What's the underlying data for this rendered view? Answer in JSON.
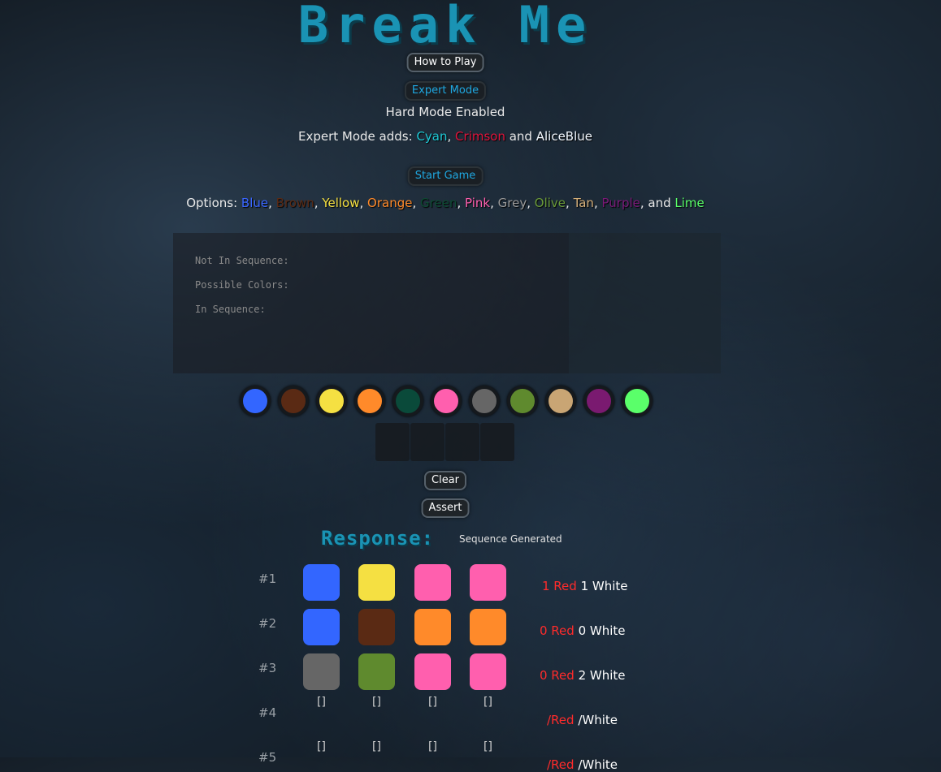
{
  "title": "Break Me",
  "buttons": {
    "how_to_play": "How to Play",
    "expert_mode": "Expert Mode",
    "start_game": "Start Game",
    "clear": "Clear",
    "assert": "Assert"
  },
  "hard_mode_text": "Hard Mode Enabled",
  "expert_text": {
    "prefix": "Expert Mode adds: ",
    "c1": "Cyan",
    "sep1": ", ",
    "c2": "Crimson",
    "sep2": " and ",
    "c3": "AliceBlue"
  },
  "options": {
    "prefix": "Options: ",
    "colors": [
      {
        "name": "Blue",
        "hex": "#3a66ff"
      },
      {
        "name": "Brown",
        "hex": "#5a2a14"
      },
      {
        "name": "Yellow",
        "hex": "#f5e042"
      },
      {
        "name": "Orange",
        "hex": "#ff8a2a"
      },
      {
        "name": "Green",
        "hex": "#0d4a32"
      },
      {
        "name": "Pink",
        "hex": "#ff5fae"
      },
      {
        "name": "Grey",
        "hex": "#9a9a9a"
      },
      {
        "name": "Olive",
        "hex": "#6a9a3a"
      },
      {
        "name": "Tan",
        "hex": "#d6b07a"
      },
      {
        "name": "Purple",
        "hex": "#7a1a78"
      },
      {
        "name": "Lime",
        "hex": "#5aff6a"
      }
    ],
    "and_text": ", and "
  },
  "analysis_labels": {
    "not_in_sequence": "Not In Sequence:",
    "possible_colors": "Possible Colors:",
    "in_sequence": "In Sequence:"
  },
  "palette": [
    "#3366ff",
    "#5a2a14",
    "#f5e042",
    "#ff8a2a",
    "#0a4a3a",
    "#ff5fae",
    "#666666",
    "#5f8a2e",
    "#c9a574",
    "#7a1a70",
    "#5aff6a"
  ],
  "response": {
    "title": "Response:",
    "status": "Sequence Generated"
  },
  "rows": [
    {
      "num": "#1",
      "pegs": [
        "#3366ff",
        "#f5e042",
        "#ff5fae",
        "#ff5fae"
      ],
      "red": "1",
      "red_label": " Red",
      "white": "1",
      "white_label": " White"
    },
    {
      "num": "#2",
      "pegs": [
        "#3366ff",
        "#5a2a14",
        "#ff8a2a",
        "#ff8a2a"
      ],
      "red": "0",
      "red_label": " Red",
      "white": "0",
      "white_label": " White"
    },
    {
      "num": "#3",
      "pegs": [
        "#666666",
        "#5f8a2e",
        "#ff5fae",
        "#ff5fae"
      ],
      "red": "0",
      "red_label": " Red",
      "white": "2",
      "white_label": " White"
    },
    {
      "num": "#4",
      "pegs": [],
      "empty": "[]",
      "red": "/",
      "red_label": "Red",
      "white": "/",
      "white_label": "White"
    },
    {
      "num": "#5",
      "pegs": [],
      "empty": "[]",
      "red": "/",
      "red_label": "Red",
      "white": "/",
      "white_label": "White"
    }
  ]
}
